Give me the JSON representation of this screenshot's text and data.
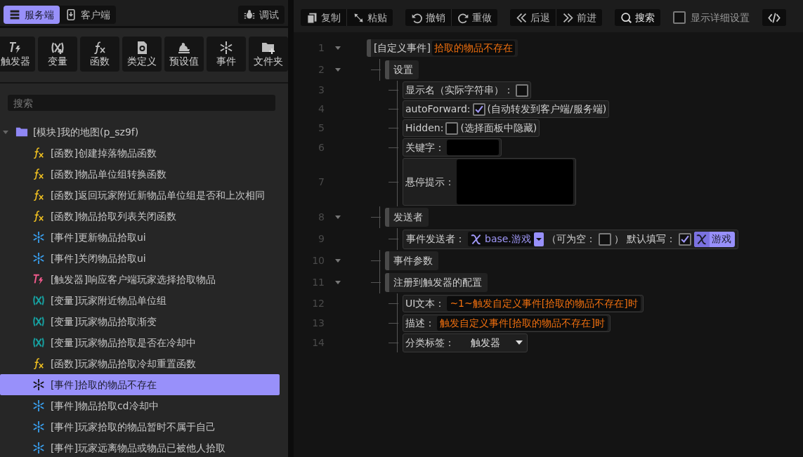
{
  "side_tabs": [
    {
      "label": "服务端",
      "selected": true
    },
    {
      "label": "客户端",
      "selected": false
    }
  ],
  "debug_button": {
    "label": "调试"
  },
  "create_buttons": [
    {
      "label": "触发器",
      "kind": "trigger"
    },
    {
      "label": "变量",
      "kind": "variable"
    },
    {
      "label": "函数",
      "kind": "function"
    },
    {
      "label": "类定义",
      "kind": "class"
    },
    {
      "label": "预设值",
      "kind": "preset"
    },
    {
      "label": "事件",
      "kind": "event"
    },
    {
      "label": "文件夹",
      "kind": "folder"
    }
  ],
  "search": {
    "placeholder": "搜索"
  },
  "tree": {
    "label": "[模块]我的地图(p_sz9f)",
    "expanded": true,
    "children": [
      {
        "label": "[函数]创建掉落物品函数",
        "kind": "function",
        "selected": false
      },
      {
        "label": "[函数]物品单位组转换函数",
        "kind": "function",
        "selected": false
      },
      {
        "label": "[函数]返回玩家附近新物品单位组是否和上次相同",
        "kind": "function",
        "selected": false
      },
      {
        "label": "[函数]物品拾取列表关闭函数",
        "kind": "function",
        "selected": false
      },
      {
        "label": "[事件]更新物品拾取ui",
        "kind": "event",
        "selected": false
      },
      {
        "label": "[事件]关闭物品拾取ui",
        "kind": "event",
        "selected": false
      },
      {
        "label": "[触发器]响应客户端玩家选择拾取物品",
        "kind": "trigger",
        "selected": false
      },
      {
        "label": "[变量]玩家附近物品单位组",
        "kind": "variable",
        "selected": false
      },
      {
        "label": "[变量]玩家物品拾取渐变",
        "kind": "variable",
        "selected": false
      },
      {
        "label": "[变量]玩家物品拾取是否在冷却中",
        "kind": "variable",
        "selected": false
      },
      {
        "label": "[函数]玩家物品拾取冷却重置函数",
        "kind": "function",
        "selected": false
      },
      {
        "label": "[事件]拾取的物品不存在",
        "kind": "event",
        "selected": true
      },
      {
        "label": "[事件]物品拾取cd冷却中",
        "kind": "event",
        "selected": false
      },
      {
        "label": "[事件]玩家拾取的物品暂时不属于自己",
        "kind": "event",
        "selected": false
      },
      {
        "label": "[事件]玩家远离物品或物品已被他人拾取",
        "kind": "event",
        "selected": false
      }
    ]
  },
  "toolbar": {
    "groups": [
      [
        {
          "label": "复制"
        },
        {
          "label": "粘贴"
        }
      ],
      [
        {
          "label": "撤销"
        },
        {
          "label": "重做"
        }
      ],
      [
        {
          "label": "后退"
        },
        {
          "label": "前进"
        }
      ],
      [
        {
          "label": "搜索"
        }
      ]
    ],
    "detail_checkbox": {
      "label": "显示详细设置",
      "checked": false
    }
  },
  "editor": {
    "lines": [
      {
        "number": "1",
        "kind": "header",
        "prefix": "[自定义事件]",
        "title": "拾取的物品不存在",
        "expanded": true,
        "children": [
          {
            "number": "2",
            "kind": "section",
            "label": "设置",
            "expanded": true,
            "children": [
              {
                "number": "3",
                "kind": "checkbox",
                "label": "显示名（实际字符串）：",
                "checked": false
              },
              {
                "number": "4",
                "kind": "checkbox",
                "label": "autoForward:",
                "checked": true,
                "note": "(自动转发到客户端/服务端)"
              },
              {
                "number": "5",
                "kind": "checkbox",
                "label": "Hidden:",
                "checked": false,
                "note": "(选择面板中隐藏)"
              },
              {
                "number": "6",
                "kind": "text",
                "label": "关键字："
              },
              {
                "number": "7",
                "kind": "textarea",
                "label": "悬停提示："
              }
            ]
          },
          {
            "number": "8",
            "kind": "section",
            "label": "发送者",
            "expanded": true,
            "children": [
              {
                "number": "9",
                "kind": "sender",
                "label": "事件发送者：",
                "value": "base.游戏",
                "nullable_label": "（可为空：",
                "nullable_checked": false,
                "nullable_close": "）",
                "default_label": "默认填写：",
                "default_checked": true,
                "default_value": "游戏"
              }
            ]
          },
          {
            "number": "10",
            "kind": "section",
            "label": "事件参数",
            "expanded": true
          },
          {
            "number": "11",
            "kind": "section",
            "label": "注册到触发器的配置",
            "expanded": true,
            "children": [
              {
                "number": "12",
                "kind": "text",
                "label": "UI文本：",
                "value": "~1~触发自定义事件[拾取的物品不存在]时"
              },
              {
                "number": "13",
                "kind": "text",
                "label": "描述：",
                "value": "触发自定义事件[拾取的物品不存在]时"
              },
              {
                "number": "14",
                "kind": "dropdown",
                "label": "分类标签：",
                "value": "触发器"
              }
            ]
          }
        ]
      }
    ]
  }
}
